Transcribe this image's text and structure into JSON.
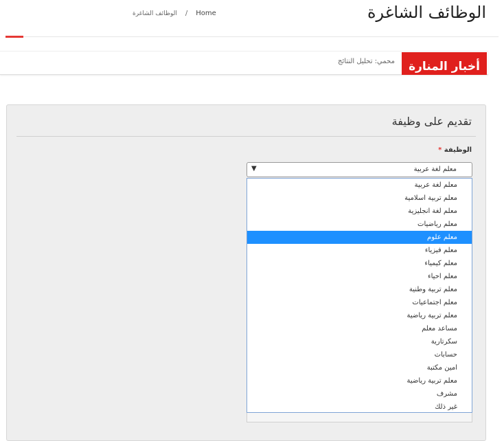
{
  "header": {
    "title": "الوظائف الشاغرة",
    "breadcrumb": {
      "home": "Home",
      "separator": "/",
      "current": "الوظائف الشاغرة"
    },
    "accent_color": "#e53935"
  },
  "news": {
    "label": "أخبار المنارة",
    "text": "محمي: تحليل النتائج",
    "label_color": "#e0201d"
  },
  "form": {
    "title": "تقديم على وظيفة",
    "job_label": "الوظيفة",
    "required_mark": "*",
    "select": {
      "value": "معلم لغة عربية",
      "arrow": "▼"
    },
    "options": [
      "معلم لغة عربية",
      "معلم تربية اسلامية",
      "معلم لغة انجليزية",
      "معلم رياضيات",
      "معلم علوم",
      "معلم فيزياء",
      "معلم كيمياء",
      "معلم احياء",
      "معلم تربية وطنية",
      "معلم اجتماعيات",
      "معلم تربية رياضية",
      "مساعد معلم",
      "سكرتارية",
      "حسابات",
      "امين مكتبة",
      "معلم تربية رياضية",
      "مشرف",
      "غير ذلك"
    ],
    "highlighted_index": 4,
    "highlight_color": "#1e90ff"
  }
}
